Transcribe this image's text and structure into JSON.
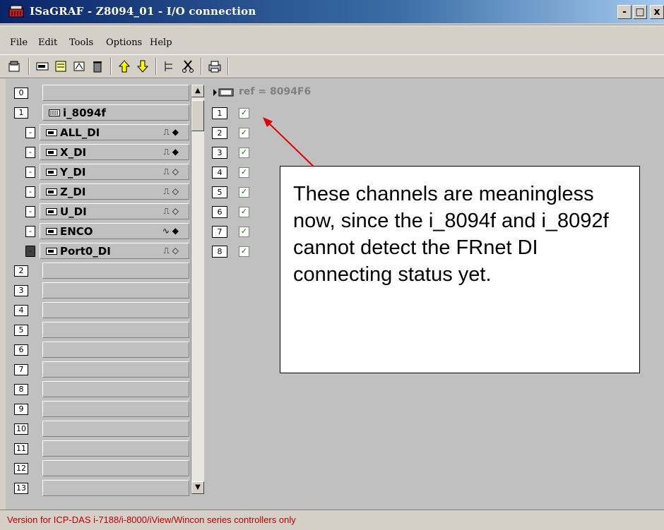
{
  "window": {
    "title": "ISaGRAF - Z8094_01 - I/O connection",
    "buttons": {
      "minimize": "-",
      "maximize": "□",
      "close": "x"
    }
  },
  "menu": [
    "File",
    "Edit",
    "Tools",
    "Options",
    "Help"
  ],
  "toolbar": {
    "icons": [
      "open-board-icon",
      "board-icon",
      "properties-icon",
      "calibrate-icon",
      "delete-icon",
      "move-up-icon",
      "move-down-icon",
      "tree-icon",
      "cut-icon",
      "print-icon"
    ]
  },
  "slots": {
    "slot0": {
      "number": "0",
      "label": ""
    },
    "slot1": {
      "number": "1",
      "label": "i_8094f"
    },
    "boards": [
      {
        "mark": "-",
        "label": "ALL_DI",
        "suffix": "⎍ ◆"
      },
      {
        "mark": "-",
        "label": "X_DI",
        "suffix": "⎍ ◆"
      },
      {
        "mark": "-",
        "label": "Y_DI",
        "suffix": "⎍ ◇"
      },
      {
        "mark": "-",
        "label": "Z_DI",
        "suffix": "⎍ ◇"
      },
      {
        "mark": "-",
        "label": "U_DI",
        "suffix": "⎍ ◇"
      },
      {
        "mark": "-",
        "label": "ENCO",
        "suffix": "∿ ◆"
      },
      {
        "mark": "-",
        "label": "Port0_DI",
        "suffix": "⎍ ◇"
      }
    ],
    "empty": [
      "2",
      "3",
      "4",
      "5",
      "6",
      "7",
      "8",
      "9",
      "10",
      "11",
      "12",
      "13"
    ]
  },
  "channels": {
    "ref": "ref = 8094F6",
    "numbers": [
      "1",
      "2",
      "3",
      "4",
      "5",
      "6",
      "7",
      "8"
    ],
    "check": "✓"
  },
  "callout": {
    "text": "These channels are meaningless now, since the i_8094f and i_8092f cannot detect the FRnet DI connecting status yet."
  },
  "status": {
    "text": "Version for ICP-DAS i-7188/i-8000/iView/Wincon series controllers only"
  }
}
